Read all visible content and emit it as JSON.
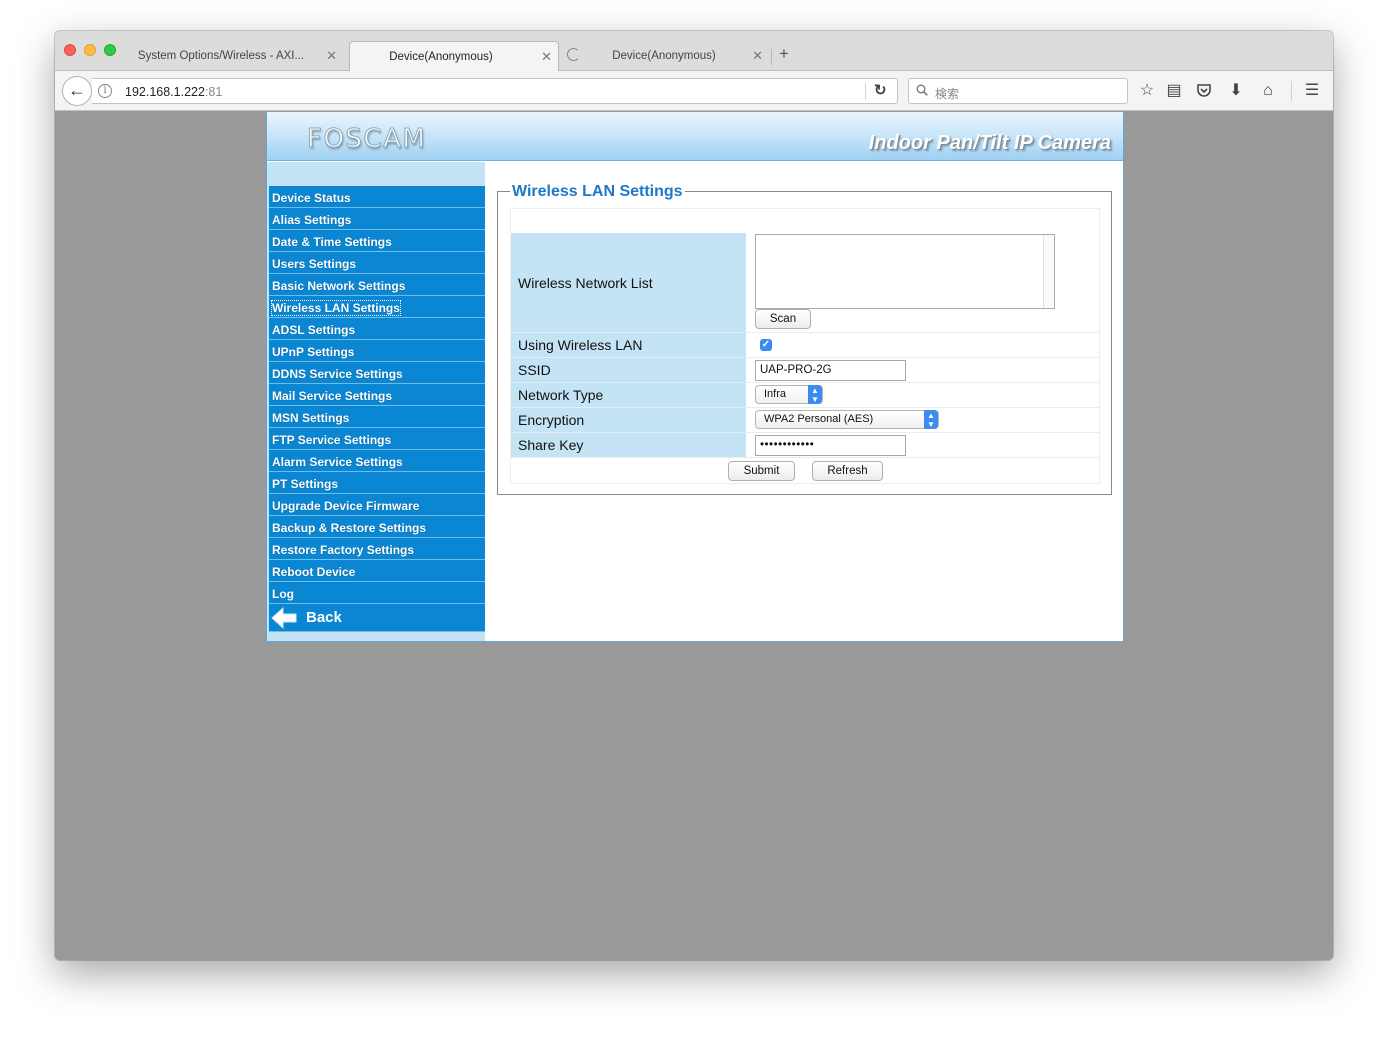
{
  "browser": {
    "tabs": [
      {
        "title": "System Options/Wireless - AXI..."
      },
      {
        "title": "Device(Anonymous)"
      },
      {
        "title": "Device(Anonymous)"
      }
    ],
    "url_host": "192.168.1.222",
    "url_port": ":81",
    "search_placeholder": "検索"
  },
  "banner": {
    "logo": "FOSCAM",
    "caption": "Indoor Pan/Tilt IP Camera"
  },
  "sidebar": {
    "items": [
      {
        "label": "Device Status"
      },
      {
        "label": "Alias Settings"
      },
      {
        "label": "Date & Time Settings"
      },
      {
        "label": "Users Settings"
      },
      {
        "label": "Basic Network Settings"
      },
      {
        "label": "Wireless LAN Settings"
      },
      {
        "label": "ADSL Settings"
      },
      {
        "label": "UPnP Settings"
      },
      {
        "label": "DDNS Service Settings"
      },
      {
        "label": "Mail Service Settings"
      },
      {
        "label": "MSN Settings"
      },
      {
        "label": "FTP Service Settings"
      },
      {
        "label": "Alarm Service Settings"
      },
      {
        "label": "PT Settings"
      },
      {
        "label": "Upgrade Device Firmware"
      },
      {
        "label": "Backup & Restore Settings"
      },
      {
        "label": "Restore Factory Settings"
      },
      {
        "label": "Reboot Device"
      },
      {
        "label": "Log"
      }
    ],
    "active_item": "Wireless LAN Settings",
    "back_label": "Back"
  },
  "form": {
    "title": "Wireless LAN Settings",
    "network_list_label": "Wireless Network List",
    "scan_label": "Scan",
    "using_wireless_label": "Using Wireless LAN",
    "using_wireless_checked": true,
    "ssid_label": "SSID",
    "ssid_value": "UAP-PRO-2G",
    "network_type_label": "Network Type",
    "network_type_value": "Infra",
    "encryption_label": "Encryption",
    "encryption_value": "WPA2 Personal (AES)",
    "share_key_label": "Share Key",
    "share_key_value": "••••••••••••",
    "submit_label": "Submit",
    "refresh_label": "Refresh"
  },
  "colors": {
    "menu_blue": "#0a86d3",
    "label_bg": "#c4e3f5",
    "legend_blue": "#1e78c8",
    "viewport_gray": "#999999"
  }
}
